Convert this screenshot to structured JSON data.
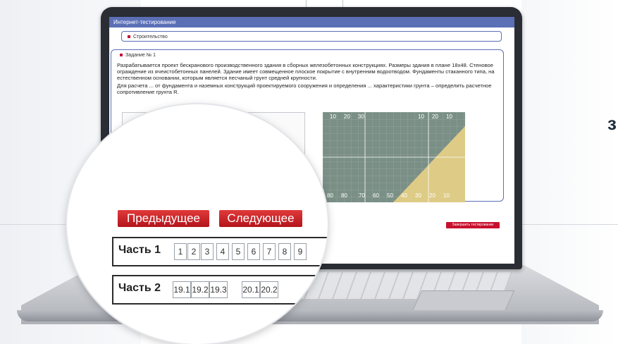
{
  "app": {
    "header_title": "Интернет-тестирование",
    "subject_label": "Строительство"
  },
  "task": {
    "title": "Задание № 1",
    "text_1": "Разрабатывается проект бескранового производственного здания в сборных железобетонных конструкциях. Размеры здания в плане 18х48. Стеновое ограждение из ячеистобетонных панелей. Здание имеет совмещенное плоское покрытие с внутренним водоотводом. Фундаменты стаканного типа, на естественном основании, которым является песчаный грунт средней крупности.",
    "text_2": "Для расчета ... от фундамента и наземных конструкций проектируемого сооружения и определения ... характеристики грунта – определить расчетное сопротивление грунта R."
  },
  "chart_labels": {
    "top": [
      "10",
      "20",
      "30",
      "10",
      "20",
      "10"
    ],
    "bottom": [
      "80",
      "80",
      "70",
      "60",
      "50",
      "40",
      "30",
      "20",
      "10"
    ]
  },
  "buttons": {
    "finish": "Завершить тестирование",
    "prev": "Предыдущее",
    "next": "Следующее"
  },
  "part1": {
    "label": "Часть 1",
    "items": [
      "1",
      "2",
      "3",
      "4",
      "5",
      "6",
      "7",
      "8",
      "9"
    ]
  },
  "part2": {
    "label": "Часть 2",
    "items": [
      "19.1",
      "19.2",
      "19.3",
      "20.1",
      "20.2"
    ]
  },
  "colors": {
    "header": "#5b6fb7",
    "accent_red": "#c8102e",
    "chart_bg": "#7a8f86",
    "chart_fill": "#e3cf86"
  },
  "edge_glyph": "з"
}
